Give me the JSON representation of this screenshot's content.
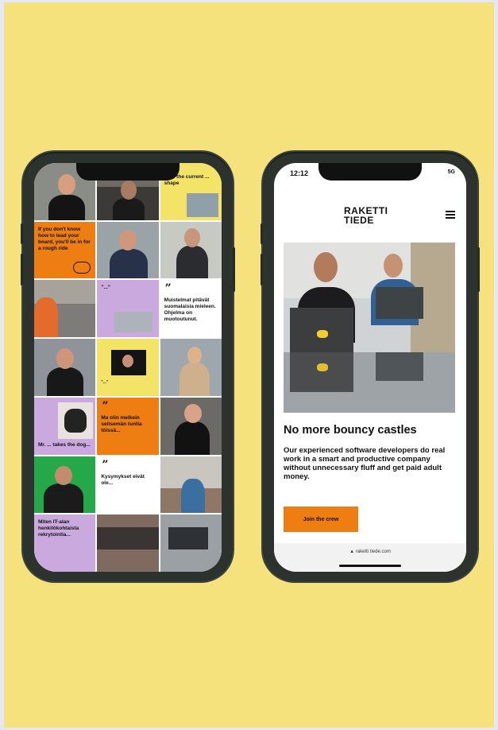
{
  "colors": {
    "background": "#f6e27d",
    "orange": "#ee7d12",
    "lilac": "#c9a9de",
    "yellow": "#f3e366",
    "phone_frame": "#2c332f"
  },
  "left_phone": {
    "tiles": [
      {
        "kind": "photo"
      },
      {
        "kind": "photo"
      },
      {
        "kind": "yellow-text",
        "text": "How the current ... shape"
      },
      {
        "kind": "orange-text",
        "text": "If you don't know how to lead your board, you'll be in for a rough ride",
        "icon": "piggy-bank-icon"
      },
      {
        "kind": "photo"
      },
      {
        "kind": "photo"
      },
      {
        "kind": "photo"
      },
      {
        "kind": "lilac-text",
        "text": "\"...\""
      },
      {
        "kind": "white-quote",
        "text": "Muistelmat pitävät suomalaisia mieleen. Ohjelma on muotoutunut."
      },
      {
        "kind": "photo"
      },
      {
        "kind": "yellow-photo",
        "text": "\"...\""
      },
      {
        "kind": "photo"
      },
      {
        "kind": "lilac-dog",
        "text": "Mr. ... takes the dog..."
      },
      {
        "kind": "orange-quote",
        "text": "Ma olin melkein seitsemän tuntia töissä..."
      },
      {
        "kind": "photo"
      },
      {
        "kind": "photo"
      },
      {
        "kind": "white-quote",
        "text": "Kysymykset eivät ole..."
      },
      {
        "kind": "photo"
      },
      {
        "kind": "lilac-text",
        "text": "Miten IT-alan henkilökohtaista rekrytointia..."
      },
      {
        "kind": "photo"
      },
      {
        "kind": "photo"
      }
    ]
  },
  "right_phone": {
    "status": {
      "time": "12:12",
      "signal": "5G"
    },
    "logo": {
      "line1": "RAKETTI",
      "line2": "TIEDE"
    },
    "headline": "No more bouncy castles",
    "body": "Our experienced software developers do real work in a smart and productive company without unnecessary fluff and get paid adult money.",
    "cta": "Join the crew",
    "url": "raketti tiede.com"
  }
}
